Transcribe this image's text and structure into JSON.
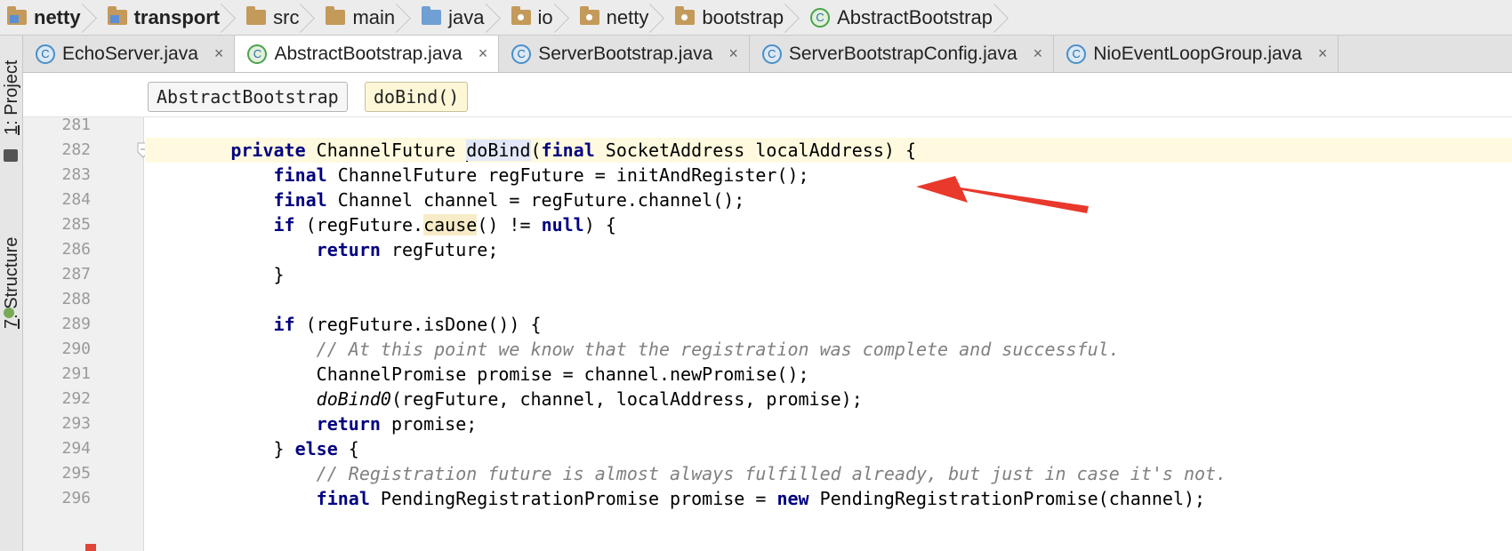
{
  "breadcrumb": [
    {
      "label": "netty",
      "icon": "module-folder-icon",
      "bold": true
    },
    {
      "label": "transport",
      "icon": "module-folder-icon",
      "bold": true
    },
    {
      "label": "src",
      "icon": "folder-icon",
      "bold": false
    },
    {
      "label": "main",
      "icon": "folder-icon",
      "bold": false
    },
    {
      "label": "java",
      "icon": "source-folder-icon",
      "bold": false
    },
    {
      "label": "io",
      "icon": "package-icon",
      "bold": false
    },
    {
      "label": "netty",
      "icon": "package-icon",
      "bold": false
    },
    {
      "label": "bootstrap",
      "icon": "package-icon",
      "bold": false
    },
    {
      "label": "AbstractBootstrap",
      "icon": "abstract-class-icon",
      "bold": false
    }
  ],
  "tabs": [
    {
      "label": "EchoServer.java",
      "icon_letter": "C",
      "active": false,
      "close": "×"
    },
    {
      "label": "AbstractBootstrap.java",
      "icon_letter": "C",
      "active": true,
      "close": "×"
    },
    {
      "label": "ServerBootstrap.java",
      "icon_letter": "C",
      "active": false,
      "close": "×"
    },
    {
      "label": "ServerBootstrapConfig.java",
      "icon_letter": "C",
      "active": false,
      "close": "×"
    },
    {
      "label": "NioEventLoopGroup.java",
      "icon_letter": "C",
      "active": false,
      "close": "×"
    }
  ],
  "side_tools": {
    "project": {
      "number": "1",
      "label": ": Project"
    },
    "structure": {
      "number": "7",
      "label": ": Structure"
    }
  },
  "nav": {
    "class_name": "AbstractBootstrap",
    "method_name": "doBind()"
  },
  "code": {
    "line_numbers": [
      "281",
      "282",
      "283",
      "284",
      "285",
      "286",
      "287",
      "288",
      "289",
      "290",
      "291",
      "292",
      "293",
      "294",
      "295",
      "296"
    ],
    "current_line": "282",
    "pointed_line": "283",
    "colors": {
      "keyword": "#000080",
      "comment": "#808080",
      "arrow": "#e8392c"
    }
  }
}
